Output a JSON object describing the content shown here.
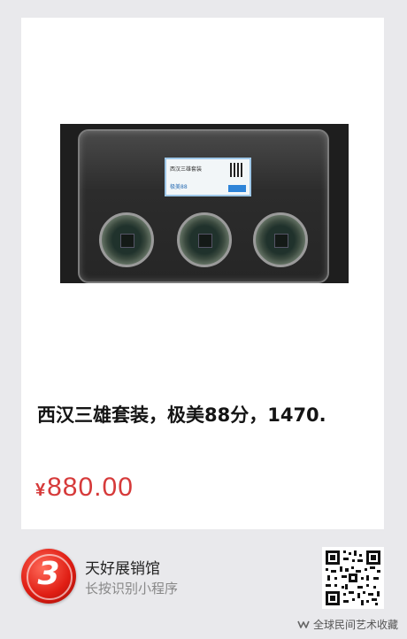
{
  "product": {
    "title": "西汉三雄套装，极美88分，1470.",
    "currency_symbol": "¥",
    "price": "880.00",
    "image_label_top": "西汉三雄套装",
    "image_label_bottom": "极美88"
  },
  "shop": {
    "name": "天好展销馆",
    "hint": "长按识别小程序",
    "logo_glyph": "3"
  },
  "watermark": {
    "text": "全球民间艺术收藏",
    "icon": "wechat-channel-icon"
  },
  "colors": {
    "price_red": "#d63a3a",
    "logo_red": "#e01e14",
    "background": "#e9e9ec"
  }
}
